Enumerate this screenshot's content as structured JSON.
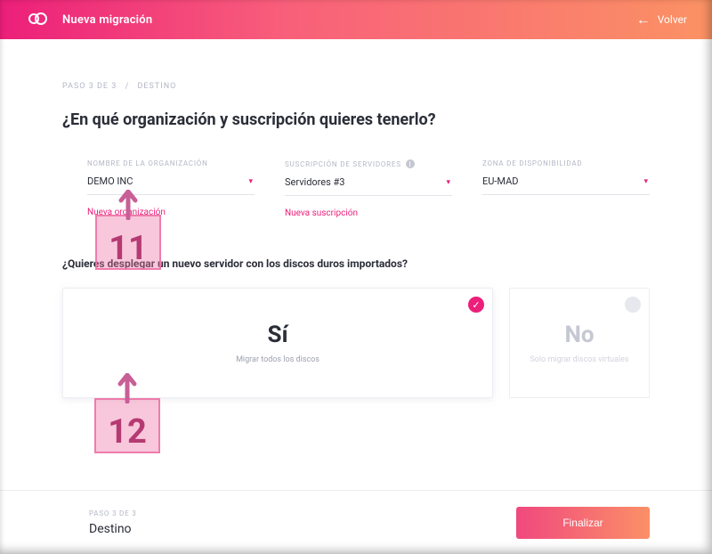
{
  "header": {
    "title": "Nueva migración",
    "back_label": "Volver"
  },
  "breadcrumb": {
    "step": "PASO 3 DE 3",
    "section": "DESTINO"
  },
  "questions": {
    "main": "¿En qué organización y suscripción quieres tenerlo?",
    "deploy": "¿Quieres desplegar un nuevo servidor con los discos duros importados?"
  },
  "selectors": {
    "org": {
      "label": "NOMBRE DE LA ORGANIZACIÓN",
      "value": "DEMO INC",
      "new": "Nueva organización"
    },
    "sub": {
      "label": "SUSCRIPCIÓN DE SERVIDORES",
      "value": "Servidores #3",
      "new": "Nueva suscripción"
    },
    "zone": {
      "label": "ZONA DE DISPONIBILIDAD",
      "value": "EU-MAD"
    }
  },
  "cards": {
    "yes": {
      "title": "Sí",
      "sub": "Migrar todos los discos"
    },
    "no": {
      "title": "No",
      "sub": "Solo migrar discos virtuales"
    }
  },
  "footer": {
    "step": "PASO 3 DE 3",
    "section": "Destino",
    "finish": "Finalizar"
  },
  "annotations": {
    "n11": "11",
    "n12": "12"
  }
}
